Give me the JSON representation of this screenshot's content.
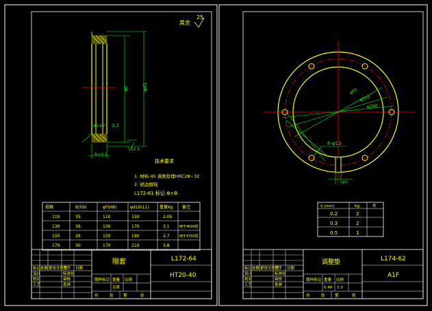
{
  "left": {
    "roughness": "25",
    "roughness_note": "其余",
    "dim_phi_c": "φC",
    "dim_phi_d1": "φd1",
    "dim_3_2": "3.2",
    "dim_4x45": "4×45°",
    "dim_12_5": "12.5",
    "dim_b_e": "B±0.1",
    "tech_title": "技术要求",
    "tech_line1": "1. 材料:45 调质处理HRC28~32",
    "tech_line2": "2. 锐边倒钝",
    "part_code": "L172-61  标记  Φ×B",
    "table_headers": [
      "规格",
      "B(h9)",
      "φF(H8)",
      "φd1(h11)",
      "重量Kg",
      "备注"
    ],
    "table_rows": [
      [
        "110",
        "35",
        "110",
        "150",
        "2.05",
        ""
      ],
      [
        "130",
        "36",
        "130",
        "170",
        "3.1",
        "用于4600机"
      ],
      [
        "150",
        "26",
        "150",
        "190",
        "2.7",
        "用于4700机"
      ],
      [
        "170",
        "30",
        "170",
        "210",
        "3.8",
        ""
      ]
    ],
    "title_name": "隔套",
    "drawing_no": "L172-64",
    "material": "HT20-40",
    "label_mark": "标记",
    "label_count": "处数",
    "label_file": "更改文件号",
    "label_sign": "签字",
    "label_date": "日期",
    "label_design": "设计",
    "label_check": "校对",
    "label_process": "工艺",
    "label_std": "标准化",
    "label_review": "审核",
    "label_approve": "批准",
    "label_stage": "图样标记",
    "label_weight": "重量",
    "label_scale": "比例",
    "label_sheet": "共",
    "label_sheet_of": "张",
    "label_page": "第",
    "label_page_of": "张",
    "label_note": "见表"
  },
  "right": {
    "dim_phi_a": "φD1",
    "dim_phi_b": "φ200",
    "dim_phi_c": "φ240",
    "holes": "6-φ13",
    "dim_s": "φ3",
    "table_headers": [
      "S (mm)",
      "Kg",
      "件"
    ],
    "table_rows": [
      [
        "0.2",
        "2",
        ""
      ],
      [
        "0.3",
        "2",
        ""
      ],
      [
        "0.5",
        "1",
        ""
      ]
    ],
    "title_name": "调整垫",
    "drawing_no": "L174-62",
    "material": "A1F",
    "weight": "0.40",
    "scale": "1:3"
  }
}
